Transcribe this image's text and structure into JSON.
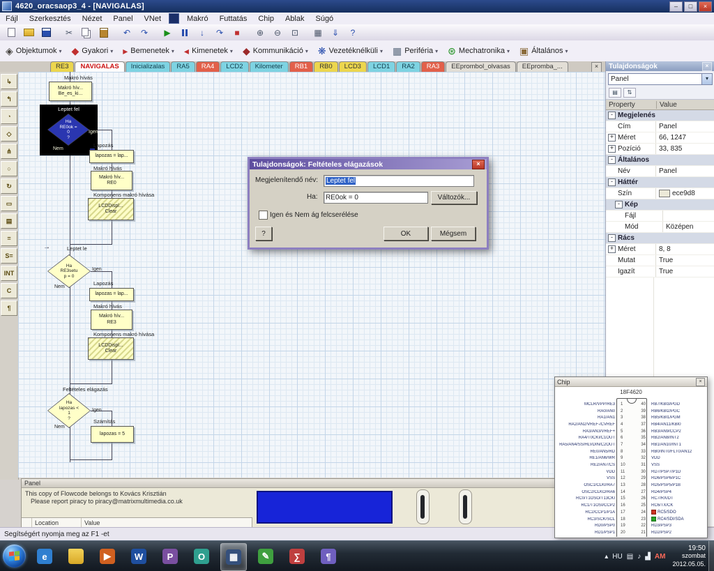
{
  "window": {
    "title": "4620_oracsaop3_4 - [NAVIGALAS]",
    "min": "–",
    "max": "□",
    "close": "×"
  },
  "icons": {
    "dropdown": "▾",
    "arrow_right": "→"
  },
  "menu_left": [
    "Fájl",
    "Szerkesztés",
    "Nézet",
    "Panel",
    "VNet"
  ],
  "menu_right": [
    "Makró",
    "Futtatás",
    "Chip",
    "Ablak",
    "Súgó"
  ],
  "toolbar": [
    {
      "name": "new-file-icon",
      "glyph": "",
      "cls": "ic-new"
    },
    {
      "name": "open-file-icon",
      "glyph": "",
      "cls": "ic-open"
    },
    {
      "name": "save-icon",
      "glyph": "",
      "cls": "ic-save"
    },
    {
      "name": "cut-icon",
      "glyph": "✂",
      "cls": "ic-txt c-gray"
    },
    {
      "name": "copy-icon",
      "glyph": "",
      "cls": "ic-copy"
    },
    {
      "name": "paste-icon",
      "glyph": "",
      "cls": "ic-paste"
    },
    {
      "name": "undo-icon",
      "glyph": "↶",
      "cls": "ic-txt c-blue"
    },
    {
      "name": "redo-icon",
      "glyph": "↷",
      "cls": "ic-txt c-blue"
    },
    {
      "name": "run-icon",
      "glyph": "▶",
      "cls": "ic-txt c-green"
    },
    {
      "name": "pause-icon",
      "glyph": "",
      "cls": "ic-pause"
    },
    {
      "name": "step-into-icon",
      "glyph": "↓",
      "cls": "ic-txt c-blue"
    },
    {
      "name": "step-over-icon",
      "glyph": "↷",
      "cls": "ic-txt c-blue"
    },
    {
      "name": "stop-icon",
      "glyph": "■",
      "cls": "ic-txt c-red"
    },
    {
      "name": "zoom-in-icon",
      "glyph": "⊕",
      "cls": "ic-txt c-gray"
    },
    {
      "name": "zoom-out-icon",
      "glyph": "⊖",
      "cls": "ic-txt c-gray"
    },
    {
      "name": "zoom-fit-icon",
      "glyph": "⊡",
      "cls": "ic-txt c-gray"
    },
    {
      "name": "chip-view-icon",
      "glyph": "▦",
      "cls": "ic-txt c-gray"
    },
    {
      "name": "compile-icon",
      "glyph": "⇓",
      "cls": "ic-txt c-blue"
    },
    {
      "name": "help-icon",
      "glyph": "?",
      "cls": "ic-txt c-blue"
    }
  ],
  "components": [
    {
      "name": "component-group-objektumok",
      "label": "Objektumok",
      "glyph": "◈",
      "iconcls": "c-dark"
    },
    {
      "name": "component-group-gyakori",
      "label": "Gyakori",
      "glyph": "◆",
      "iconcls": "c-red"
    },
    {
      "name": "component-group-bemenetek",
      "label": "Bemenetek",
      "glyph": "▸",
      "iconcls": "c-red"
    },
    {
      "name": "component-group-kimenetek",
      "label": "Kimenetek",
      "glyph": "◂",
      "iconcls": "c-red"
    },
    {
      "name": "component-group-kommunikacio",
      "label": "Kommunikáció",
      "glyph": "◆",
      "iconcls": "c-darkred"
    },
    {
      "name": "component-group-vezeteknelkuli",
      "label": "Vezetéknélküli",
      "glyph": "❋",
      "iconcls": "c-blue"
    },
    {
      "name": "component-group-periferia",
      "label": "Periféria",
      "glyph": "▦",
      "iconcls": "c-slate"
    },
    {
      "name": "component-group-mechatronika",
      "label": "Mechatronika",
      "glyph": "⊛",
      "iconcls": "c-green"
    },
    {
      "name": "component-group-altalanos",
      "label": "Általános",
      "glyph": "▣",
      "iconcls": "c-brown"
    }
  ],
  "tabs": [
    {
      "label": "RE3",
      "cls": "t-yellow"
    },
    {
      "label": "NAVIGALAS",
      "cls": "t-active"
    },
    {
      "label": "Inicializalas",
      "cls": "t-cyan"
    },
    {
      "label": "RA5",
      "cls": "t-cyan"
    },
    {
      "label": "RA4",
      "cls": "t-red"
    },
    {
      "label": "LCD2",
      "cls": "t-cyan"
    },
    {
      "label": "Kilometer",
      "cls": "t-cyan"
    },
    {
      "label": "RB1",
      "cls": "t-red"
    },
    {
      "label": "RB0",
      "cls": "t-yellow"
    },
    {
      "label": "LCD3",
      "cls": "t-yellow"
    },
    {
      "label": "LCD1",
      "cls": "t-cyan"
    },
    {
      "label": "RA2",
      "cls": "t-cyan"
    },
    {
      "label": "RA3",
      "cls": "t-red"
    },
    {
      "label": "EEprombol_olvasas",
      "cls": "t-plain"
    },
    {
      "label": "EEpromba_...",
      "cls": "t-plain"
    }
  ],
  "tabstrip_close": "×",
  "tools": [
    {
      "name": "input-icon",
      "glyph": "↳"
    },
    {
      "name": "output-icon",
      "glyph": "↰"
    },
    {
      "name": "delay-icon",
      "glyph": "◔"
    },
    {
      "name": "decision-icon",
      "glyph": "◇"
    },
    {
      "name": "switch-icon",
      "glyph": "⋔"
    },
    {
      "name": "connection-point-icon",
      "glyph": "○"
    },
    {
      "name": "loop-icon",
      "glyph": "↻"
    },
    {
      "name": "macro-call-icon",
      "glyph": "▭"
    },
    {
      "name": "component-macro-icon",
      "glyph": "▤"
    },
    {
      "name": "calculation-icon",
      "glyph": "="
    },
    {
      "name": "string-function-icon",
      "glyph": "S="
    },
    {
      "name": "interrupt-icon",
      "glyph": "INT"
    },
    {
      "name": "c-code-icon",
      "glyph": "C"
    },
    {
      "name": "comment-icon",
      "glyph": "¶"
    }
  ],
  "flow": {
    "call_label": "Makró hívás",
    "component_label": "Komponens makró hívása",
    "branch_label": "Feltételes elágazás",
    "calc_label": "Számítás",
    "paging_label": "Lapozás",
    "step_down_label": "Leptet le",
    "yes": "Igen",
    "no": "Nem",
    "macro1": {
      "l1": "Makró hív...",
      "l2": "Be_es_ki..."
    },
    "selected": {
      "name": "Leptet fel",
      "c1": "Ha",
      "c2": "RE0ok =",
      "c3": "0",
      "c4": "?"
    },
    "lap_box": "lapozas = lap...",
    "macro_re0": {
      "l1": "Makró hív...",
      "l2": "RE0"
    },
    "lcd_box": {
      "l1": "LCDDispl...",
      "l2": "Clear"
    },
    "d2": {
      "c1": "Ha",
      "c2": "RE3setu",
      "c3": "p = 0"
    },
    "macro_re3": {
      "l1": "Makró hív...",
      "l2": "RE3"
    },
    "d3": {
      "c1": "Ha",
      "c2": "lapozas <",
      "c3": "1",
      "c4": "?"
    },
    "calc_box": "lapozas = 5"
  },
  "dialog": {
    "title": "Tulajdonságok: Feltételes elágazások",
    "close": "×",
    "name_label": "Megjelenítendő név:",
    "name_value": "Leptet fel",
    "if_label": "Ha:",
    "if_value": "RE0ok = 0",
    "variables_btn": "Változók...",
    "swap_label": "Igen és Nem ág felcserélése",
    "help_btn": "?",
    "ok_btn": "OK",
    "cancel_btn": "Mégsem"
  },
  "props": {
    "title": "Tulajdonságok",
    "close": "×",
    "combo": "Panel",
    "col_property": "Property",
    "col_value": "Value",
    "minitools": [
      {
        "name": "categorize-icon",
        "glyph": "▤"
      },
      {
        "name": "sort-az-icon",
        "glyph": "⇅"
      }
    ],
    "rows": [
      {
        "cls": "group",
        "box": "-",
        "name": "Megjelenés",
        "value": ""
      },
      {
        "cls": "prop",
        "box": "",
        "name": "Cím",
        "value": "Panel"
      },
      {
        "cls": "prop",
        "box": "+",
        "name": "Méret",
        "value": "66, 1247"
      },
      {
        "cls": "prop",
        "box": "+",
        "name": "Pozíció",
        "value": "33, 835"
      },
      {
        "cls": "group",
        "box": "-",
        "name": "Általános",
        "value": ""
      },
      {
        "cls": "prop",
        "box": "",
        "name": "Név",
        "value": "Panel"
      },
      {
        "cls": "group",
        "box": "-",
        "name": "Háttér",
        "value": ""
      },
      {
        "cls": "prop swatch",
        "box": "",
        "name": "Szín",
        "value": "ece9d8"
      },
      {
        "cls": "group sub",
        "box": "-",
        "name": "Kép",
        "value": ""
      },
      {
        "cls": "prop sub",
        "box": "",
        "name": "Fájl",
        "value": ""
      },
      {
        "cls": "prop sub",
        "box": "",
        "name": "Mód",
        "value": "Középen"
      },
      {
        "cls": "group",
        "box": "-",
        "name": "Rács",
        "value": ""
      },
      {
        "cls": "prop",
        "box": "+",
        "name": "Méret",
        "value": "8, 8"
      },
      {
        "cls": "prop",
        "box": "",
        "name": "Mutat",
        "value": "True"
      },
      {
        "cls": "prop",
        "box": "",
        "name": "Igazít",
        "value": "True"
      }
    ]
  },
  "chip": {
    "title": "Chip",
    "close": "×",
    "device": "18F4620",
    "pins": [
      {
        "l": "MCLR/VPP/RE3",
        "ln": 1,
        "rn": 40,
        "r": "RB7/KBI3/PGD"
      },
      {
        "l": "RA0/AN0",
        "ln": 2,
        "rn": 39,
        "r": "RB6/KBI2/PGC"
      },
      {
        "l": "RA1/AN1",
        "ln": 3,
        "rn": 38,
        "r": "RB5/KBI1/PGM"
      },
      {
        "l": "RA2/AN2/VREF-/CVREF",
        "ln": 4,
        "rn": 37,
        "r": "RB4/AN11/KBI0"
      },
      {
        "l": "RA3/AN3/VREF+",
        "ln": 5,
        "rn": 36,
        "r": "RB3/AN9/CCP2"
      },
      {
        "l": "RA4/T0CKI/C1OUT",
        "ln": 6,
        "rn": 35,
        "r": "RB2/AN8/INT2"
      },
      {
        "l": "RA5/AN4/SS/HLVDIN/C2OUT",
        "ln": 7,
        "rn": 34,
        "r": "RB1/AN10/INT1"
      },
      {
        "l": "RE0/AN5/RD",
        "ln": 8,
        "rn": 33,
        "r": "RB0/INT0/FLT0/AN12"
      },
      {
        "l": "RE1/AN6/WR",
        "ln": 9,
        "rn": 32,
        "r": "VDD"
      },
      {
        "l": "RE2/AN7/CS",
        "ln": 10,
        "rn": 31,
        "r": "VSS"
      },
      {
        "l": "VDD",
        "ln": 11,
        "rn": 30,
        "r": "RD7/PSP7/P1D"
      },
      {
        "l": "VSS",
        "ln": 12,
        "rn": 29,
        "r": "RD6/PSP6/P1C"
      },
      {
        "l": "OSC1/CLKI/RA7",
        "ln": 13,
        "rn": 28,
        "r": "RD5/PSP5/P1B"
      },
      {
        "l": "OSC2/CLKO/RA6",
        "ln": 14,
        "rn": 27,
        "r": "RD4/PSP4"
      },
      {
        "l": "RC0/T1OSO/T13CKI",
        "ln": 15,
        "rn": 26,
        "r": "RC7/RX/DT"
      },
      {
        "l": "RC1/T1OSI/CCP2",
        "ln": 16,
        "rn": 25,
        "r": "RC6/TX/CK"
      },
      {
        "l": "RC2/CCP1/P1A",
        "ln": 17,
        "rn": 24,
        "r": "RC5/SDO",
        "rm": "red"
      },
      {
        "l": "RC3/SCK/SCL",
        "ln": 18,
        "rn": 23,
        "r": "RC4/SDI/SDA",
        "rm": "green"
      },
      {
        "l": "RD0/PSP0",
        "ln": 19,
        "rn": 22,
        "r": "RD3/PSP3"
      },
      {
        "l": "RD1/PSP1",
        "ln": 20,
        "rn": 21,
        "r": "RD2/PSP2"
      }
    ]
  },
  "panel": {
    "title": "Panel",
    "line1": "This copy of Flowcode belongs to Kovács Krisztián",
    "line2": "Please report piracy to piracy@matrixmultimedia.co.uk",
    "col_location": "Location",
    "col_value": "Value"
  },
  "statusbar": {
    "text": "Segítségért nyomja meg az F1 -et"
  },
  "taskbar": {
    "apps": [
      {
        "name": "taskbar-app-internet-explorer",
        "glyph": "e",
        "cls": "sq-blue"
      },
      {
        "name": "taskbar-app-windows-explorer",
        "glyph": "",
        "cls": "sq-folder"
      },
      {
        "name": "taskbar-app-media-player",
        "glyph": "▶",
        "cls": "sq-orange"
      },
      {
        "name": "taskbar-app-word",
        "glyph": "W",
        "cls": "sq-navy"
      },
      {
        "name": "taskbar-app-photoshop",
        "glyph": "P",
        "cls": "sq-purple"
      },
      {
        "name": "taskbar-app-outlook",
        "glyph": "O",
        "cls": "sq-teal"
      },
      {
        "name": "taskbar-app-flowcode",
        "glyph": "▦",
        "cls": "sq-chip active"
      },
      {
        "name": "taskbar-app-paint",
        "glyph": "✎",
        "cls": "sq-green"
      },
      {
        "name": "taskbar-app-calculator",
        "glyph": "∑",
        "cls": "sq-red"
      },
      {
        "name": "taskbar-app-notepad",
        "glyph": "¶",
        "cls": "sq-violet"
      }
    ],
    "tray_icons": [
      {
        "name": "tray-expand-icon",
        "glyph": "▴",
        "cls": ""
      },
      {
        "name": "tray-language-indicator",
        "glyph": "HU",
        "cls": ""
      },
      {
        "name": "tray-keyboard-icon",
        "glyph": "▤",
        "cls": ""
      },
      {
        "name": "tray-volume-icon",
        "glyph": "♪",
        "cls": ""
      },
      {
        "name": "tray-network-icon",
        "glyph": "▟",
        "cls": ""
      },
      {
        "name": "tray-alert-icon",
        "glyph": "AM",
        "cls": "tray-red"
      }
    ],
    "clock": {
      "time": "19:50",
      "day": "szombat",
      "date": "2012.05.05."
    }
  }
}
